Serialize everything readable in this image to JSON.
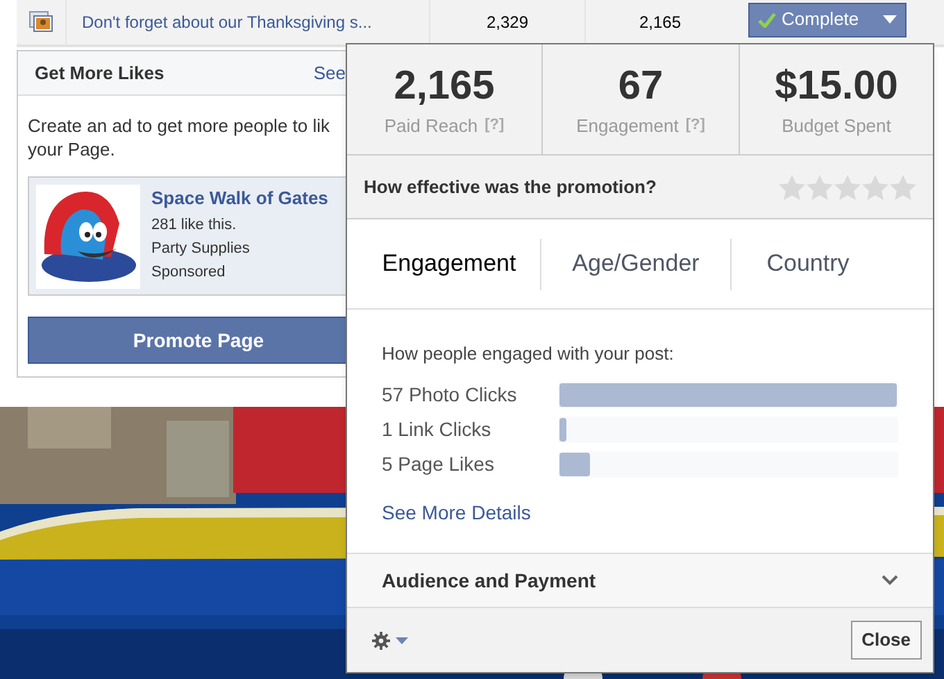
{
  "post_row": {
    "title": "Don't forget about our Thanksgiving s...",
    "column_2": "2,329",
    "column_3": "2,165",
    "status_button": "Complete"
  },
  "get_more_likes": {
    "title": "Get More Likes",
    "link": "See",
    "description_lines": [
      "Create an ad to get more people to lik",
      "your Page."
    ],
    "ad": {
      "title": "Space Walk of Gates",
      "likes": "281 like this.",
      "category": "Party Supplies",
      "label": "Sponsored"
    },
    "button": "Promote Page"
  },
  "promotion_popup": {
    "stats": [
      {
        "value": "2,165",
        "label": "Paid Reach",
        "help": "[?]"
      },
      {
        "value": "67",
        "label": "Engagement",
        "help": "[?]"
      },
      {
        "value": "$15.00",
        "label": "Budget Spent"
      }
    ],
    "rating": {
      "question": "How effective was the promotion?",
      "stars": 0
    },
    "tabs": [
      {
        "label": "Engagement",
        "selected": true
      },
      {
        "label": "Age/Gender",
        "selected": false
      },
      {
        "label": "Country",
        "selected": false
      }
    ],
    "engagement": {
      "heading": "How people engaged with your post:",
      "rows": [
        {
          "label": "57 Photo Clicks",
          "level": 1
        },
        {
          "label": "1 Link Clicks",
          "level": 0.02
        },
        {
          "label": "5 Page Likes",
          "level": 0.09
        }
      ],
      "link": "See More Details"
    },
    "section": {
      "title": "Audience and Payment",
      "expanded": false
    },
    "close_button": "Close"
  }
}
